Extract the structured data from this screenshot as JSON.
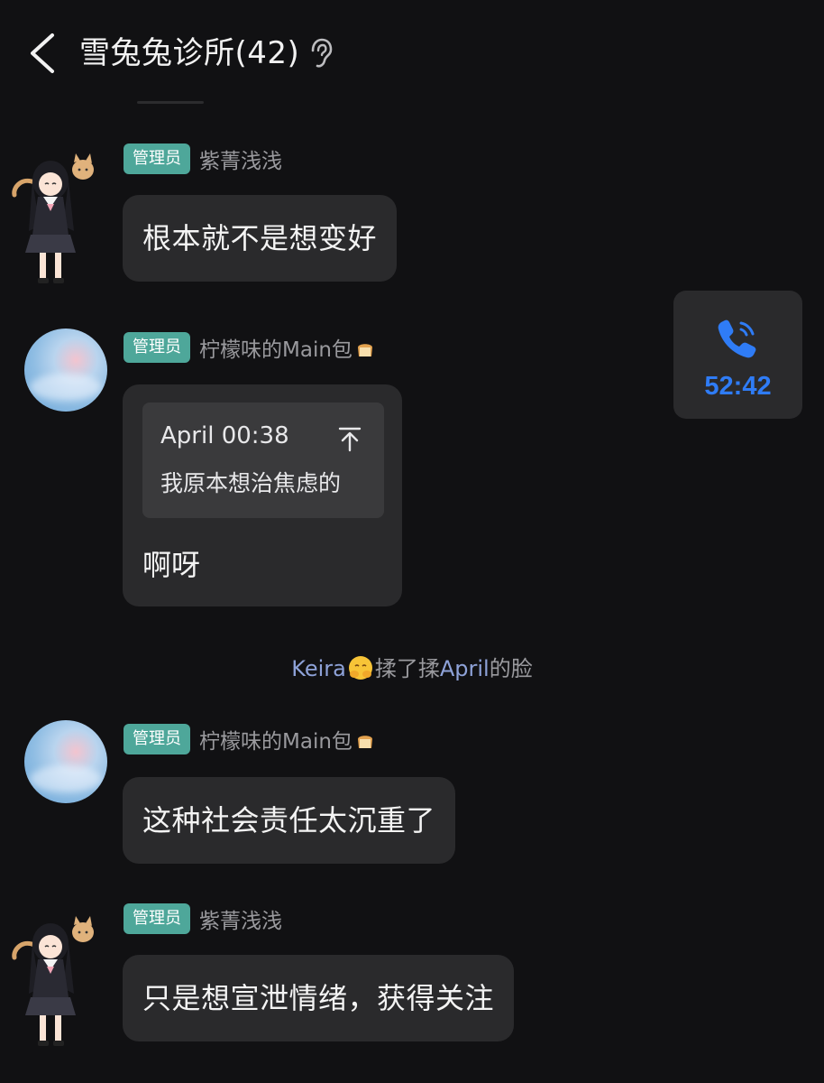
{
  "header": {
    "title": "雪兔兔诊所(42)",
    "back_icon": "chevron-left-icon",
    "ear_icon": "ear-icon"
  },
  "messages": [
    {
      "sender": "紫菁浅浅",
      "badge": "管理员",
      "avatar": "anime-girl-with-cat",
      "text": "根本就不是想变好"
    },
    {
      "sender": "柠檬味的Main包",
      "sender_emoji": "bread-emoji",
      "badge": "管理员",
      "avatar": "sky-photo",
      "quote": {
        "meta": "April 00:38",
        "text": "我原本想治焦虑的"
      },
      "text": "啊呀"
    },
    {
      "sender": "柠檬味的Main包",
      "sender_emoji": "bread-emoji",
      "badge": "管理员",
      "avatar": "sky-photo",
      "text": "这种社会责任太沉重了"
    },
    {
      "sender": "紫菁浅浅",
      "badge": "管理员",
      "avatar": "anime-girl-with-cat",
      "text": "只是想宣泄情绪，获得关注"
    }
  ],
  "system": {
    "actor": "Keira",
    "actor_emoji": "hugging-face-emoji",
    "action": "揉了揉",
    "target": "April",
    "suffix": "的脸"
  },
  "call": {
    "icon": "phone-icon",
    "duration": "52:42",
    "color": "#2f7cf6"
  },
  "colors": {
    "background": "#111113",
    "bubble": "#2a2a2c",
    "badge": "#4ea79a",
    "link_name": "#8ea2d8"
  }
}
